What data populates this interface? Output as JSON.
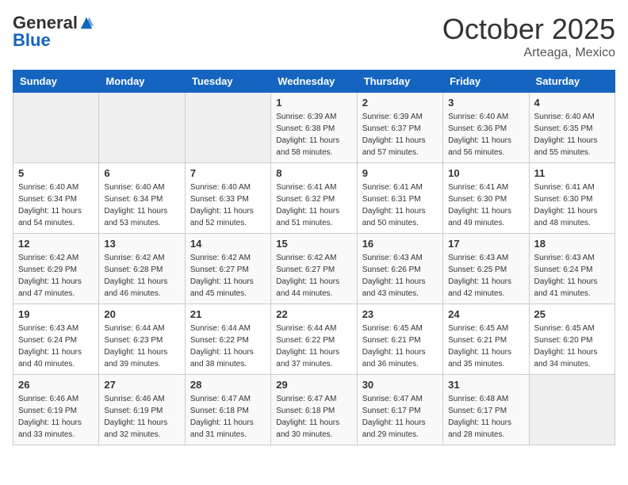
{
  "header": {
    "logo_general": "General",
    "logo_blue": "Blue",
    "month_title": "October 2025",
    "location": "Arteaga, Mexico"
  },
  "weekdays": [
    "Sunday",
    "Monday",
    "Tuesday",
    "Wednesday",
    "Thursday",
    "Friday",
    "Saturday"
  ],
  "weeks": [
    [
      {
        "day": "",
        "sunrise": "",
        "sunset": "",
        "daylight": "",
        "empty": true
      },
      {
        "day": "",
        "sunrise": "",
        "sunset": "",
        "daylight": "",
        "empty": true
      },
      {
        "day": "",
        "sunrise": "",
        "sunset": "",
        "daylight": "",
        "empty": true
      },
      {
        "day": "1",
        "sunrise": "Sunrise: 6:39 AM",
        "sunset": "Sunset: 6:38 PM",
        "daylight": "Daylight: 11 hours and 58 minutes."
      },
      {
        "day": "2",
        "sunrise": "Sunrise: 6:39 AM",
        "sunset": "Sunset: 6:37 PM",
        "daylight": "Daylight: 11 hours and 57 minutes."
      },
      {
        "day": "3",
        "sunrise": "Sunrise: 6:40 AM",
        "sunset": "Sunset: 6:36 PM",
        "daylight": "Daylight: 11 hours and 56 minutes."
      },
      {
        "day": "4",
        "sunrise": "Sunrise: 6:40 AM",
        "sunset": "Sunset: 6:35 PM",
        "daylight": "Daylight: 11 hours and 55 minutes."
      }
    ],
    [
      {
        "day": "5",
        "sunrise": "Sunrise: 6:40 AM",
        "sunset": "Sunset: 6:34 PM",
        "daylight": "Daylight: 11 hours and 54 minutes."
      },
      {
        "day": "6",
        "sunrise": "Sunrise: 6:40 AM",
        "sunset": "Sunset: 6:34 PM",
        "daylight": "Daylight: 11 hours and 53 minutes."
      },
      {
        "day": "7",
        "sunrise": "Sunrise: 6:40 AM",
        "sunset": "Sunset: 6:33 PM",
        "daylight": "Daylight: 11 hours and 52 minutes."
      },
      {
        "day": "8",
        "sunrise": "Sunrise: 6:41 AM",
        "sunset": "Sunset: 6:32 PM",
        "daylight": "Daylight: 11 hours and 51 minutes."
      },
      {
        "day": "9",
        "sunrise": "Sunrise: 6:41 AM",
        "sunset": "Sunset: 6:31 PM",
        "daylight": "Daylight: 11 hours and 50 minutes."
      },
      {
        "day": "10",
        "sunrise": "Sunrise: 6:41 AM",
        "sunset": "Sunset: 6:30 PM",
        "daylight": "Daylight: 11 hours and 49 minutes."
      },
      {
        "day": "11",
        "sunrise": "Sunrise: 6:41 AM",
        "sunset": "Sunset: 6:30 PM",
        "daylight": "Daylight: 11 hours and 48 minutes."
      }
    ],
    [
      {
        "day": "12",
        "sunrise": "Sunrise: 6:42 AM",
        "sunset": "Sunset: 6:29 PM",
        "daylight": "Daylight: 11 hours and 47 minutes."
      },
      {
        "day": "13",
        "sunrise": "Sunrise: 6:42 AM",
        "sunset": "Sunset: 6:28 PM",
        "daylight": "Daylight: 11 hours and 46 minutes."
      },
      {
        "day": "14",
        "sunrise": "Sunrise: 6:42 AM",
        "sunset": "Sunset: 6:27 PM",
        "daylight": "Daylight: 11 hours and 45 minutes."
      },
      {
        "day": "15",
        "sunrise": "Sunrise: 6:42 AM",
        "sunset": "Sunset: 6:27 PM",
        "daylight": "Daylight: 11 hours and 44 minutes."
      },
      {
        "day": "16",
        "sunrise": "Sunrise: 6:43 AM",
        "sunset": "Sunset: 6:26 PM",
        "daylight": "Daylight: 11 hours and 43 minutes."
      },
      {
        "day": "17",
        "sunrise": "Sunrise: 6:43 AM",
        "sunset": "Sunset: 6:25 PM",
        "daylight": "Daylight: 11 hours and 42 minutes."
      },
      {
        "day": "18",
        "sunrise": "Sunrise: 6:43 AM",
        "sunset": "Sunset: 6:24 PM",
        "daylight": "Daylight: 11 hours and 41 minutes."
      }
    ],
    [
      {
        "day": "19",
        "sunrise": "Sunrise: 6:43 AM",
        "sunset": "Sunset: 6:24 PM",
        "daylight": "Daylight: 11 hours and 40 minutes."
      },
      {
        "day": "20",
        "sunrise": "Sunrise: 6:44 AM",
        "sunset": "Sunset: 6:23 PM",
        "daylight": "Daylight: 11 hours and 39 minutes."
      },
      {
        "day": "21",
        "sunrise": "Sunrise: 6:44 AM",
        "sunset": "Sunset: 6:22 PM",
        "daylight": "Daylight: 11 hours and 38 minutes."
      },
      {
        "day": "22",
        "sunrise": "Sunrise: 6:44 AM",
        "sunset": "Sunset: 6:22 PM",
        "daylight": "Daylight: 11 hours and 37 minutes."
      },
      {
        "day": "23",
        "sunrise": "Sunrise: 6:45 AM",
        "sunset": "Sunset: 6:21 PM",
        "daylight": "Daylight: 11 hours and 36 minutes."
      },
      {
        "day": "24",
        "sunrise": "Sunrise: 6:45 AM",
        "sunset": "Sunset: 6:21 PM",
        "daylight": "Daylight: 11 hours and 35 minutes."
      },
      {
        "day": "25",
        "sunrise": "Sunrise: 6:45 AM",
        "sunset": "Sunset: 6:20 PM",
        "daylight": "Daylight: 11 hours and 34 minutes."
      }
    ],
    [
      {
        "day": "26",
        "sunrise": "Sunrise: 6:46 AM",
        "sunset": "Sunset: 6:19 PM",
        "daylight": "Daylight: 11 hours and 33 minutes."
      },
      {
        "day": "27",
        "sunrise": "Sunrise: 6:46 AM",
        "sunset": "Sunset: 6:19 PM",
        "daylight": "Daylight: 11 hours and 32 minutes."
      },
      {
        "day": "28",
        "sunrise": "Sunrise: 6:47 AM",
        "sunset": "Sunset: 6:18 PM",
        "daylight": "Daylight: 11 hours and 31 minutes."
      },
      {
        "day": "29",
        "sunrise": "Sunrise: 6:47 AM",
        "sunset": "Sunset: 6:18 PM",
        "daylight": "Daylight: 11 hours and 30 minutes."
      },
      {
        "day": "30",
        "sunrise": "Sunrise: 6:47 AM",
        "sunset": "Sunset: 6:17 PM",
        "daylight": "Daylight: 11 hours and 29 minutes."
      },
      {
        "day": "31",
        "sunrise": "Sunrise: 6:48 AM",
        "sunset": "Sunset: 6:17 PM",
        "daylight": "Daylight: 11 hours and 28 minutes."
      },
      {
        "day": "",
        "sunrise": "",
        "sunset": "",
        "daylight": "",
        "empty": true
      }
    ]
  ]
}
